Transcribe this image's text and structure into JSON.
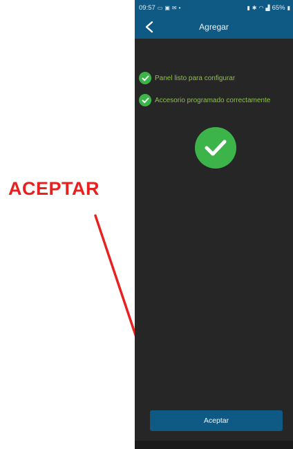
{
  "annotation": {
    "text": "ACEPTAR",
    "color": "#e8211f"
  },
  "statusbar": {
    "time": "09:57",
    "left_icons": [
      "mail-icon",
      "image-icon",
      "message-icon",
      "dot-icon"
    ],
    "right_icons": [
      "vibrate-icon",
      "bluetooth-icon",
      "wifi-icon",
      "signal-icon",
      "battery-icon"
    ],
    "battery": "65%"
  },
  "appbar": {
    "title": "Agregar",
    "back_icon": "chevron-left-icon"
  },
  "steps": [
    {
      "label": "Panel listo para configurar"
    },
    {
      "label": "Accesorio programado correctamente"
    }
  ],
  "accept_button": {
    "label": "Aceptar"
  },
  "colors": {
    "primary": "#0e5a84",
    "success": "#3cb44a",
    "success_text": "#8bc53f",
    "background": "#262626"
  }
}
